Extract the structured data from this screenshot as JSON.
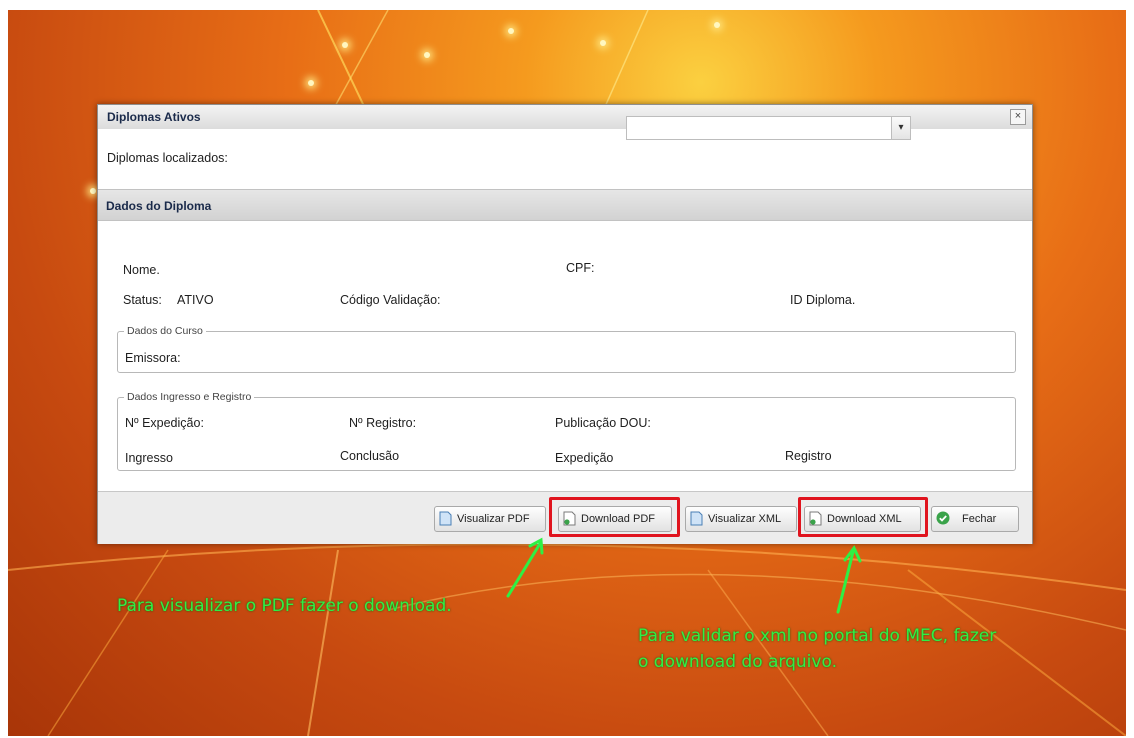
{
  "dialog": {
    "title": "Diplomas Ativos",
    "close_symbol": "×",
    "found_label": "Diplomas localizados:",
    "select_arrow": "▾"
  },
  "section": {
    "title": "Dados do Diploma"
  },
  "diploma": {
    "nome_label": "Nome.",
    "cpf_label": "CPF:",
    "status_label": "Status:",
    "status_value": "ATIVO",
    "codigo_label": "Código Validação:",
    "id_label": "ID Diploma."
  },
  "curso": {
    "legend": "Dados do Curso",
    "emissora_label": "Emissora:"
  },
  "ingresso": {
    "legend": "Dados Ingresso e Registro",
    "expedicao_num_label": "Nº Expedição:",
    "registro_num_label": "Nº Registro:",
    "publicacao_label": "Publicação DOU:",
    "ingresso_label": "Ingresso",
    "conclusao_label": "Conclusão",
    "expedicao_label": "Expedição",
    "registro_label": "Registro"
  },
  "buttons": {
    "visualizar_pdf": "Visualizar PDF",
    "download_pdf": "Download PDF",
    "visualizar_xml": "Visualizar XML",
    "download_xml": "Download XML",
    "fechar": "Fechar"
  },
  "annotations": {
    "pdf_note": "Para visualizar o PDF fazer o download.",
    "xml_note_line1": "Para validar o xml no portal do MEC, fazer",
    "xml_note_line2": "o download do arquivo."
  },
  "colors": {
    "highlight": "#e0141e",
    "annotation": "#2ef044",
    "background": "#e86e16"
  }
}
